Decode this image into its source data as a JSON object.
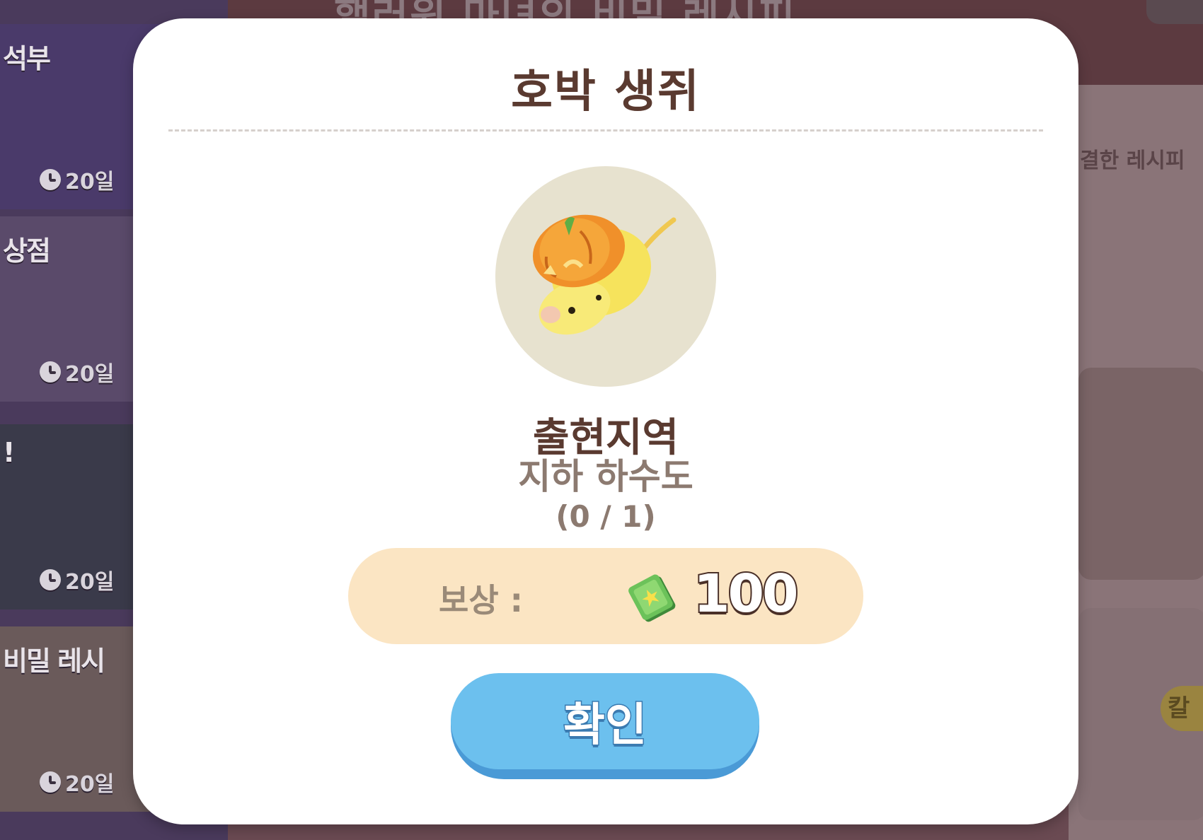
{
  "background": {
    "header_title": "핼러윈 마녀의 비밀 레시피",
    "left_cards": [
      {
        "title": "석부",
        "timer": "20일"
      },
      {
        "title": "상점",
        "timer": "20일"
      },
      {
        "title": "!",
        "timer": "20일"
      },
      {
        "title": "비밀 레시",
        "timer": "20일"
      }
    ],
    "right_text": "결한 레시피",
    "right_badge": "칼"
  },
  "modal": {
    "title": "호박 생쥐",
    "portrait_icon": "pumpkin-mouse",
    "location_label": "출현지역",
    "location_value": "지하 하수도",
    "progress": "(0 / 1)",
    "reward": {
      "label": "보상 :",
      "icon": "cash-bundle-icon",
      "amount": "100"
    },
    "confirm_label": "확인"
  },
  "colors": {
    "modal_bg": "#ffffff",
    "title_text": "#5a3a30",
    "muted_text": "#8c7a70",
    "portrait_bg": "#e7e2cf",
    "reward_bar": "#fbe5c3",
    "button_face": "#6cc0ee",
    "button_shadow": "#4a9ad6"
  }
}
